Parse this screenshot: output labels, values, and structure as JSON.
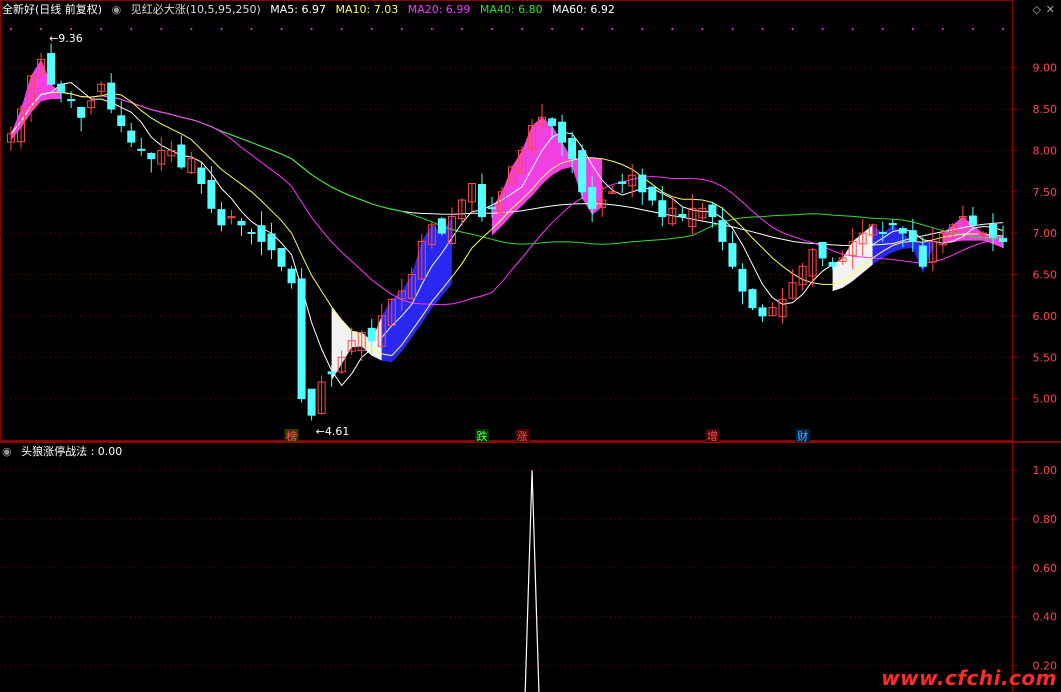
{
  "colors": {
    "bg": "#000000",
    "frame": "#8b0000",
    "grid": "#7a0000",
    "up": "#ff4a4a",
    "down": "#54ffff",
    "ma5": "#ffffff",
    "ma10": "#ffff55",
    "ma20": "#ff33ff",
    "ma40": "#33dd33",
    "ma60": "#ffffff",
    "band_blue": "#2a2aff",
    "band_white": "#ffffff",
    "band_magenta": "#ff44ee",
    "sub_line": "#ffffff",
    "axis_text": "#ff4444",
    "watermark": "#ff2a2a"
  },
  "header": {
    "stock": "全新好(日线 前复权)",
    "indicator": "见红必大涨(10,5,95,250)",
    "ma5": "MA5: 6.97",
    "ma10": "MA10: 7.03",
    "ma20": "MA20: 6.99",
    "ma40": "MA40: 6.80",
    "ma60": "MA60: 6.92"
  },
  "sub_header": {
    "title": "头狼涨停战法 : 0.00"
  },
  "markers": [
    {
      "text": "榜",
      "color": "#ff5555",
      "bg": "#443300",
      "x_index": 28
    },
    {
      "text": "跌",
      "color": "#55ff55",
      "bg": "#003300",
      "x_index": 47
    },
    {
      "text": "涨",
      "color": "#ff5555",
      "bg": "#440000",
      "x_index": 51
    },
    {
      "text": "增",
      "color": "#ff5555",
      "bg": "#440000",
      "x_index": 70
    },
    {
      "text": "财",
      "color": "#55aaff",
      "bg": "#002244",
      "x_index": 79
    }
  ],
  "annotations": {
    "high": "9.36",
    "low": "4.61"
  },
  "watermark": "www.cfchi.com",
  "chart_data": [
    {
      "type": "candlestick",
      "title": "全新好(日线 前复权)",
      "ylim": [
        4.5,
        9.6
      ],
      "y_ticks": [
        5.0,
        5.5,
        6.0,
        6.5,
        7.0,
        7.5,
        8.0,
        8.5,
        9.0
      ],
      "y_tick_labels": [
        "5.00",
        "5.50",
        "6.00",
        "6.50",
        "7.00",
        "7.50",
        "8.00",
        "8.50",
        "9.00"
      ],
      "close_series": [
        8.2,
        8.5,
        8.9,
        9.1,
        8.8,
        8.7,
        8.6,
        8.4,
        8.6,
        8.8,
        8.5,
        8.3,
        8.1,
        8.0,
        7.9,
        8.0,
        8.0,
        7.8,
        7.9,
        7.6,
        7.3,
        7.1,
        7.2,
        7.1,
        7.0,
        6.9,
        6.8,
        6.6,
        6.4,
        5.0,
        4.8,
        5.2,
        5.3,
        5.5,
        5.7,
        5.8,
        5.7,
        6.0,
        6.2,
        6.3,
        6.5,
        6.9,
        7.1,
        7.0,
        7.2,
        7.4,
        7.6,
        7.2,
        7.3,
        7.5,
        7.8,
        8.0,
        8.3,
        8.4,
        8.3,
        8.1,
        7.9,
        7.5,
        7.3,
        7.4,
        7.5,
        7.6,
        7.7,
        7.5,
        7.4,
        7.2,
        7.3,
        7.2,
        7.3,
        7.3,
        7.2,
        6.9,
        6.6,
        6.3,
        6.1,
        6.0,
        6.1,
        6.2,
        6.4,
        6.6,
        6.8,
        6.7,
        6.6,
        6.7,
        6.9,
        7.0,
        7.1,
        7.0,
        7.1,
        7.0,
        6.9,
        6.6,
        6.9,
        7.0,
        7.1,
        7.2,
        7.1,
        7.0,
        6.95,
        6.9
      ],
      "ma5_last": 6.97,
      "ma10_last": 7.03,
      "ma20_last": 6.99,
      "ma40_last": 6.8,
      "ma60_last": 6.92
    },
    {
      "type": "line",
      "title": "头狼涨停战法",
      "ylim": [
        0.1,
        1.05
      ],
      "y_ticks": [
        0.2,
        0.4,
        0.6,
        0.8,
        1.0
      ],
      "y_tick_labels": [
        "0.20",
        "0.40",
        "0.60",
        "0.80",
        "1.00"
      ],
      "spike_index": 52,
      "last_value": 0.0
    }
  ]
}
